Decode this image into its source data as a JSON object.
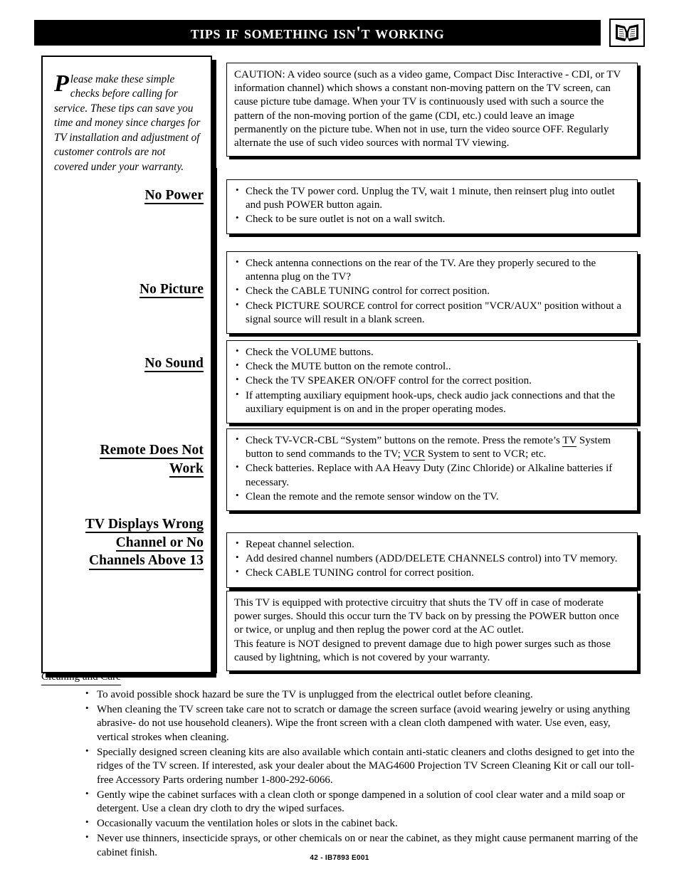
{
  "header": {
    "title": "Tips If Something Isn't Working",
    "icon": "open-book-icon"
  },
  "intro": {
    "dropcap": "P",
    "text": "lease make these simple checks before calling for service.  These tips can save you time and money since charges for TV installation and adjustment of customer controls are not covered under your warranty."
  },
  "caution": {
    "text": "CAUTION: A video source (such as a video game, Compact Disc Interactive - CDI, or TV information channel) which shows a constant non-moving pattern on the TV screen, can cause picture tube damage. When your TV is continuously used with such a source the pattern of the non-moving portion of the game (CDI, etc.) could leave an image permanently on the picture tube. When not in use, turn the video source OFF. Regularly alternate the use of such video sources with normal TV viewing."
  },
  "sections": [
    {
      "heading": "No Power",
      "items": [
        "Check the TV power cord. Unplug the TV, wait 1 minute, then reinsert plug into outlet and push POWER button again.",
        "Check to be sure outlet is not on a wall switch."
      ]
    },
    {
      "heading": "No Picture",
      "items": [
        "Check antenna connections on the rear of the TV. Are they properly secured to the antenna plug on the TV?",
        "Check the CABLE TUNING control for correct position.",
        "Check PICTURE SOURCE control for correct position \"VCR/AUX\" position without a signal source will result in a blank screen."
      ]
    },
    {
      "heading": "No Sound",
      "items": [
        "Check the VOLUME buttons.",
        "Check the MUTE button on the remote control..",
        "Check the TV SPEAKER ON/OFF control for the correct position.",
        "If attempting auxiliary equipment hook-ups, check audio jack connections and that the auxiliary equipment is on and in the proper operating modes."
      ]
    },
    {
      "heading": "Remote Does Not Work",
      "heading_line1": "Remote Does Not",
      "heading_line2": "Work",
      "items": [
        {
          "parts": [
            {
              "t": "Check TV-VCR-CBL “System” buttons on the remote. Press the remote’s ",
              "u": false
            },
            {
              "t": "TV",
              "u": true
            },
            {
              "t": " System button to send commands to the TV; ",
              "u": false
            },
            {
              "t": "VCR",
              "u": true
            },
            {
              "t": " System to sent to VCR; etc.",
              "u": false
            }
          ]
        },
        {
          "parts": [
            {
              "t": "Check batteries.  Replace with AA Heavy Duty (Zinc Chloride) or Alkaline batteries if necessary.",
              "u": false
            }
          ]
        },
        {
          "parts": [
            {
              "t": "Clean the remote and the remote sensor window on the TV.",
              "u": false
            }
          ]
        }
      ]
    },
    {
      "heading": "TV Displays Wrong Channel or No Channels Above 13",
      "heading_line1": "TV Displays Wrong",
      "heading_line2": "Channel or No",
      "heading_line3": "Channels Above 13",
      "items": [
        "Repeat channel selection.",
        "Add desired channel numbers (ADD/DELETE CHANNELS control) into TV memory.",
        "Check CABLE TUNING control for correct position."
      ]
    }
  ],
  "surge": {
    "paragraph1": "This TV is equipped with protective circuitry that shuts the TV off in case of moderate power surges. Should this occur turn the TV back on by pressing the POWER button once or twice, or unplug and then replug the power cord at the AC outlet.",
    "paragraph2": "This feature is NOT designed to prevent damage due to high power surges such as those caused by lightning, which is not covered by your warranty."
  },
  "cleaning": {
    "title": "Cleaning and Care",
    "items": [
      "To avoid possible shock hazard be sure the TV is unplugged from the electrical outlet before cleaning.",
      "When cleaning the TV screen take care not to scratch or damage the screen surface (avoid wearing jewelry or using anything abrasive- do not use household cleaners). Wipe the front screen with a clean cloth dampened with water.  Use even, easy, vertical strokes when cleaning.",
      "Specially designed screen cleaning kits are also available which contain anti-static cleaners and cloths designed to get into the ridges of the TV screen. If interested, ask your dealer about the MAG4600 Projection TV Screen Cleaning Kit or call our toll-free Accessory Parts ordering number 1-800-292-6066.",
      "Gently wipe the cabinet surfaces with a clean cloth or sponge dampened in a solution of cool clear water and a mild soap or detergent. Use a clean dry cloth to dry the wiped surfaces.",
      "Occasionally vacuum the ventilation holes or slots in the cabinet back.",
      "Never use thinners, insecticide sprays, or other chemicals on or near the cabinet, as they might cause permanent marring of the cabinet finish."
    ]
  },
  "footer": {
    "text": "42 - IB7893 E001"
  }
}
